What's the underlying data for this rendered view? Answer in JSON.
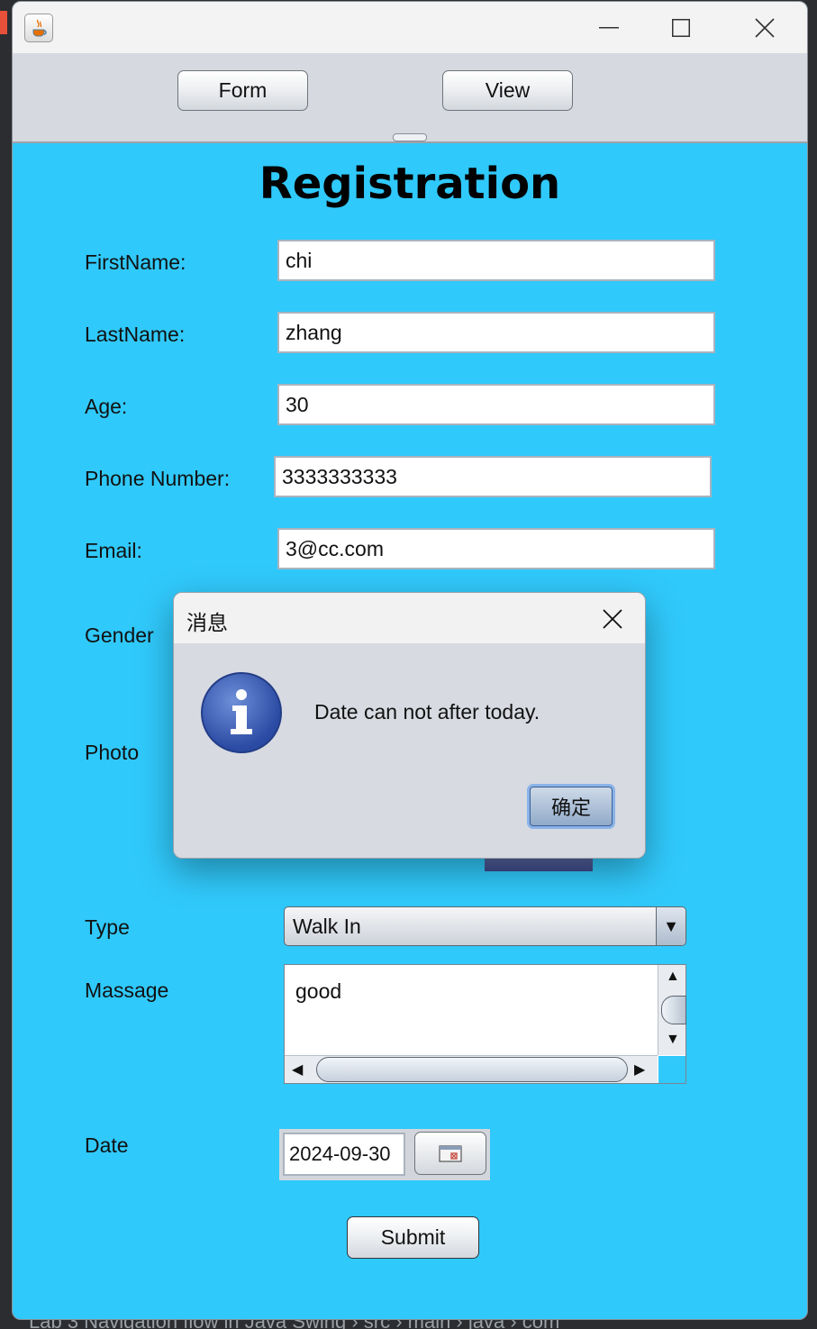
{
  "ide": {
    "breadcrumb": "Lab 3 Navigation flow in Java Swing  ›  src  ›  main  ›  java  ›  com"
  },
  "window": {
    "title": "",
    "controls": {
      "minimize": "minimize-icon",
      "maximize": "maximize-icon",
      "close": "close-icon"
    }
  },
  "toolbar": {
    "form_label": "Form",
    "view_label": "View"
  },
  "form": {
    "heading": "Registration",
    "first_name_label": "FirstName:",
    "first_name_value": "chi",
    "last_name_label": "LastName:",
    "last_name_value": "zhang",
    "age_label": "Age:",
    "age_value": "30",
    "phone_label": "Phone Number:",
    "phone_value": "3333333333",
    "email_label": "Email:",
    "email_value": "3@cc.com",
    "gender_label": "Gender",
    "photo_label": "Photo",
    "type_label": "Type",
    "type_value": "Walk In",
    "message_label": "Massage",
    "message_value": "good",
    "date_label": "Date",
    "date_value": "2024-09-30",
    "submit_label": "Submit"
  },
  "dialog": {
    "title": "消息",
    "message": "Date can not after today.",
    "ok_label": "确定",
    "icon": "info-icon"
  },
  "colors": {
    "content_bg": "#30c9fb",
    "toolbar_bg": "#d6d9df",
    "dialog_bg": "#d7dae1"
  }
}
